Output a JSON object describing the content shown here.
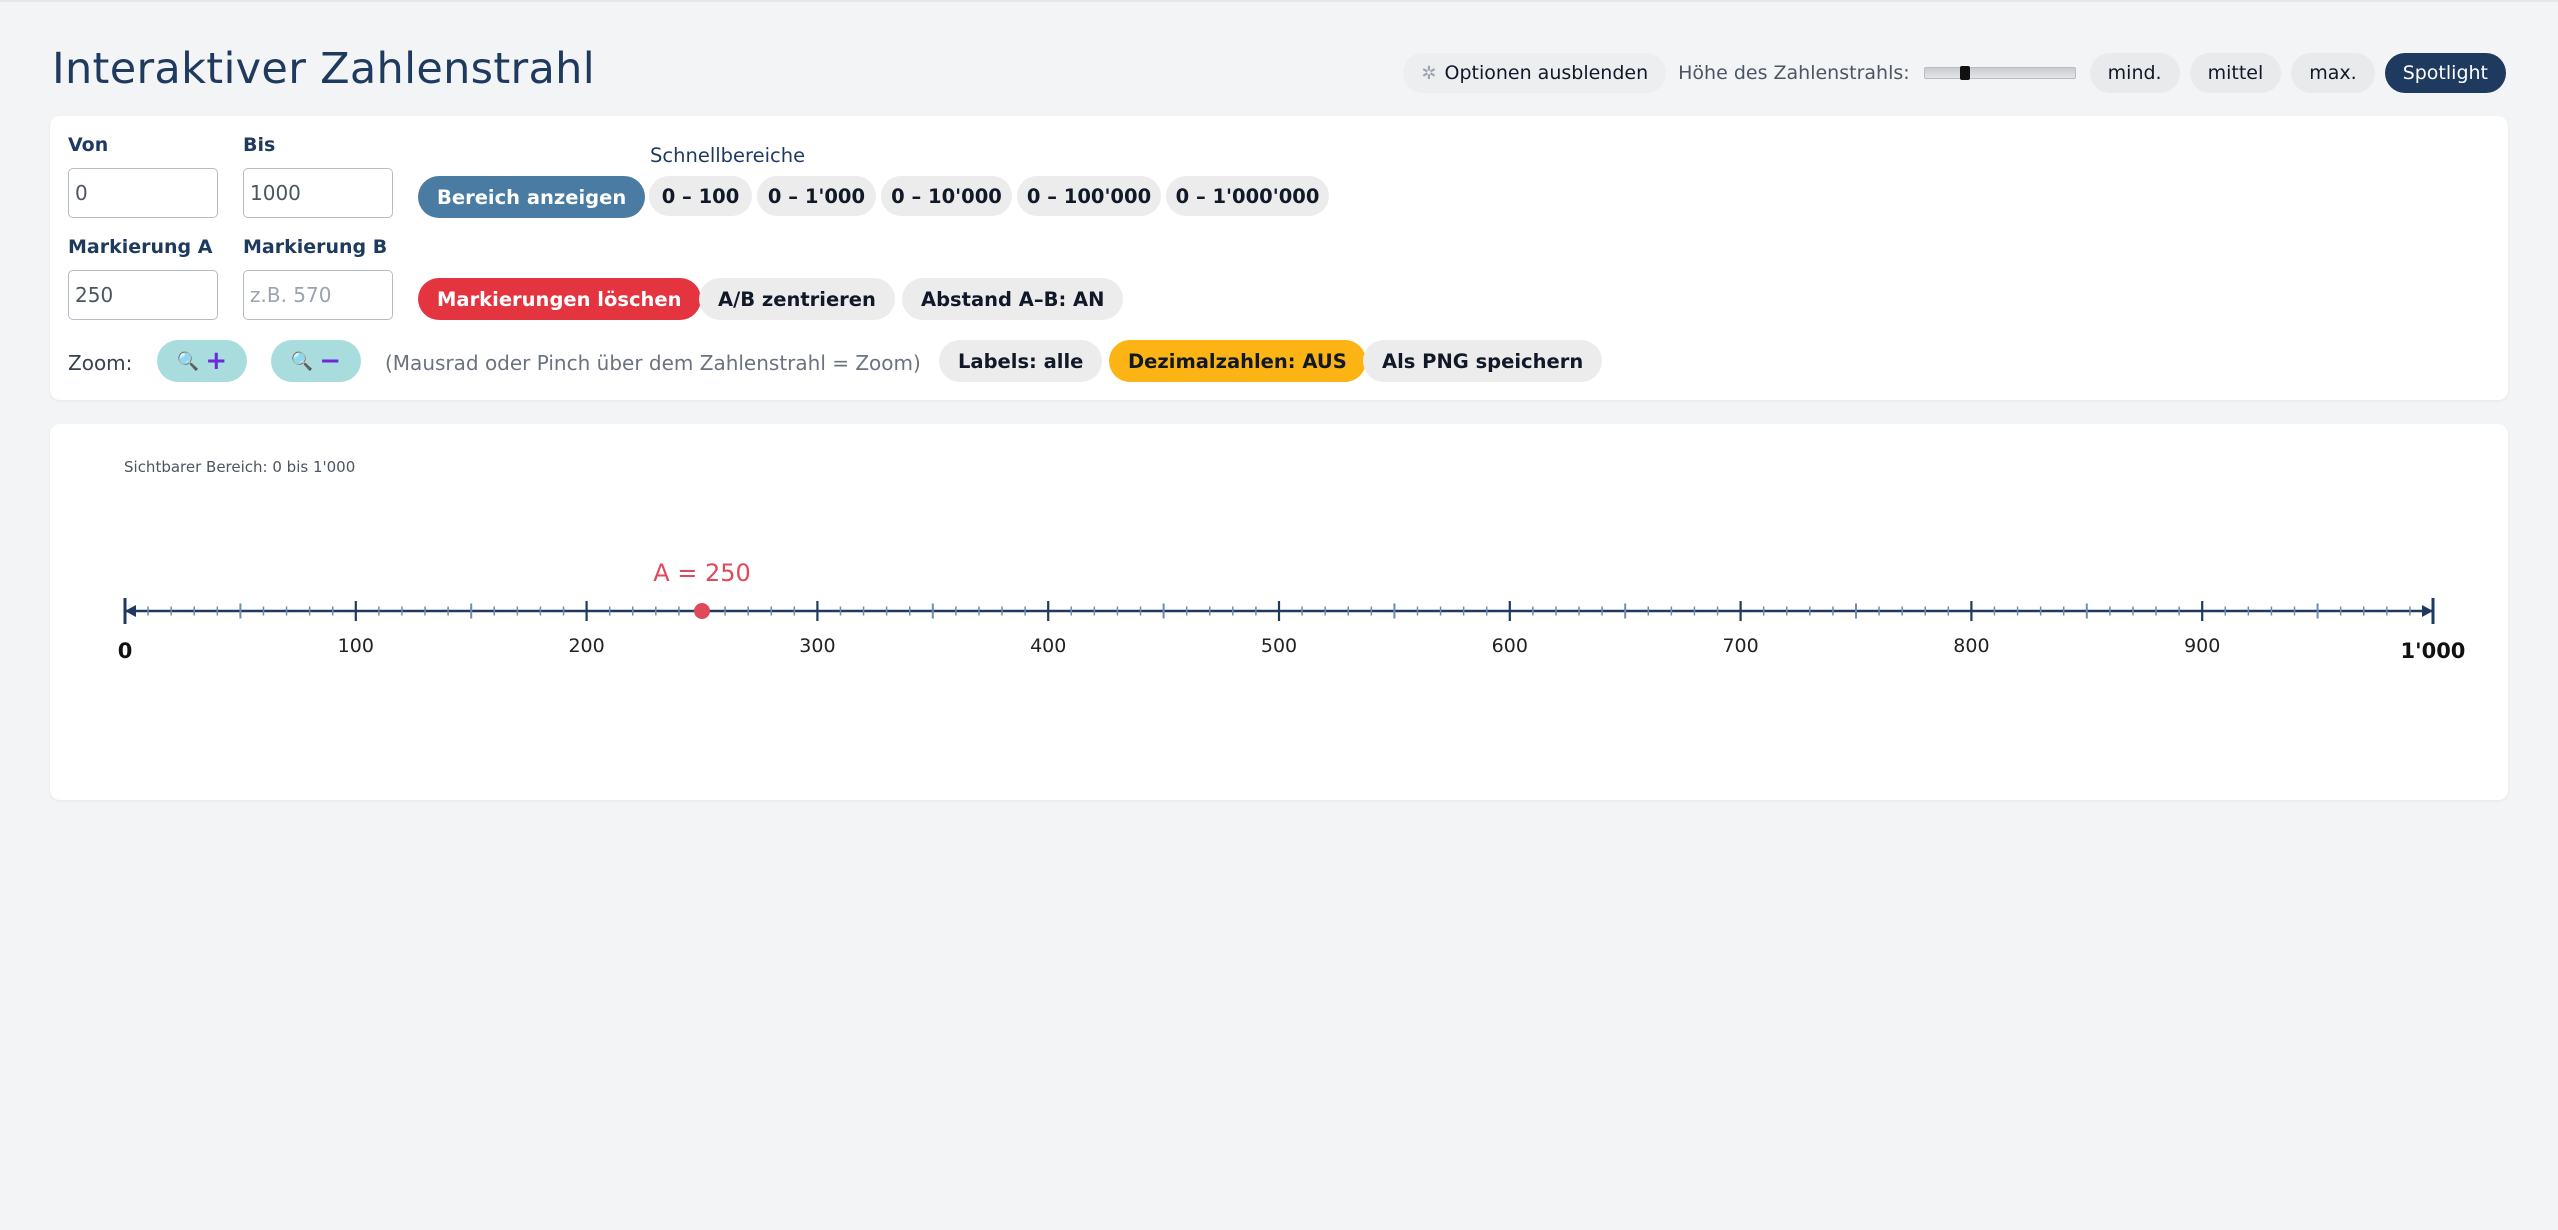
{
  "header": {
    "title": "Interaktiver Zahlenstrahl",
    "options_button": "Optionen ausblenden",
    "options_icon": "gear-icon",
    "height_label": "Höhe des Zahlenstrahls:",
    "height_slider_value": 0.25,
    "size_buttons": [
      "mind.",
      "mittel",
      "max."
    ],
    "spotlight_button": "Spotlight"
  },
  "controls": {
    "from_label": "Von",
    "from_value": "0",
    "to_label": "Bis",
    "to_value": "1000",
    "show_range_button": "Bereich anzeigen",
    "quick_label": "Schnellbereiche",
    "quick_ranges": [
      "0 – 100",
      "0 – 1'000",
      "0 – 10'000",
      "0 – 100'000",
      "0 – 1'000'000"
    ],
    "marker_a_label": "Markierung A",
    "marker_a_value": "250",
    "marker_b_label": "Markierung B",
    "marker_b_placeholder": "z.B. 570",
    "clear_markers_button": "Markierungen löschen",
    "center_ab_button": "A/B zentrieren",
    "distance_button": "Abstand A–B: AN",
    "zoom_label": "Zoom:",
    "zoom_in_icon": "zoom-in-icon",
    "zoom_out_icon": "zoom-out-icon",
    "zoom_hint": "(Mausrad oder Pinch über dem Zahlenstrahl = Zoom)",
    "labels_button": "Labels: alle",
    "decimals_button": "Dezimalzahlen: AUS",
    "save_png_button": "Als PNG speichern"
  },
  "number_line": {
    "visible_range": "Sichtbarer Bereich: 0 bis 1'000",
    "min": 0,
    "max": 1000,
    "major_step": 100,
    "medium_step": 50,
    "minor_step": 10,
    "start_label": "0",
    "end_label": "1'000",
    "tick_labels": [
      "100",
      "200",
      "300",
      "400",
      "500",
      "600",
      "700",
      "800",
      "900"
    ],
    "marker_a": {
      "value": 250,
      "label": "A = 250",
      "color": "#e0495a"
    },
    "line_color": "#1e3a5f",
    "minor_tick_color": "#6a8db0"
  },
  "colors": {
    "primary": "#1e3a5f",
    "blue_button": "#4a7ca3",
    "red_button": "#e3343f",
    "amber_button": "#fcb415",
    "teal_button": "#a9dddd"
  }
}
